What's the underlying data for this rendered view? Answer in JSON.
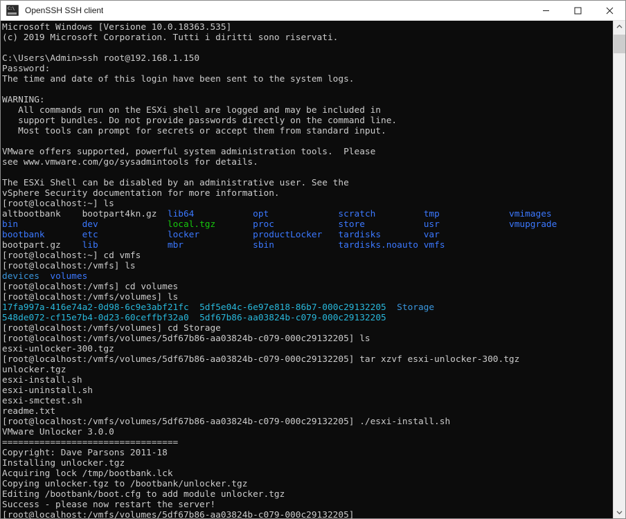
{
  "window": {
    "title": "OpenSSH SSH client",
    "icon": "console-icon",
    "controls": {
      "minimize": "Minimize",
      "maximize": "Maximize",
      "close": "Close"
    }
  },
  "scrollbar": {
    "up_arrow": "scroll-up",
    "down_arrow": "scroll-down",
    "thumb": "scroll-thumb"
  },
  "colors": {
    "background": "#0c0c0c",
    "foreground": "#cccccc",
    "blue": "#3b78ff",
    "green": "#16c60c",
    "cyan": "#29b8db",
    "teal": "#3a96dd",
    "titlebar_bg": "#ffffff",
    "titlebar_fg": "#1a1a1a",
    "scrollbar_bg": "#f0f0f0",
    "scrollbar_thumb": "#cdcdcd"
  },
  "terminal": {
    "lines": [
      {
        "text": "Microsoft Windows [Versione 10.0.18363.535]"
      },
      {
        "text": "(c) 2019 Microsoft Corporation. Tutti i diritti sono riservati."
      },
      {
        "text": ""
      },
      {
        "text": "C:\\Users\\Admin>ssh root@192.168.1.150"
      },
      {
        "text": "Password:"
      },
      {
        "text": "The time and date of this login have been sent to the system logs."
      },
      {
        "text": ""
      },
      {
        "text": "WARNING:"
      },
      {
        "text": "   All commands run on the ESXi shell are logged and may be included in"
      },
      {
        "text": "   support bundles. Do not provide passwords directly on the command line."
      },
      {
        "text": "   Most tools can prompt for secrets or accept them from standard input."
      },
      {
        "text": ""
      },
      {
        "text": "VMware offers supported, powerful system administration tools.  Please"
      },
      {
        "text": "see www.vmware.com/go/sysadmintools for details."
      },
      {
        "text": ""
      },
      {
        "text": "The ESXi Shell can be disabled by an administrative user. See the"
      },
      {
        "text": "vSphere Security documentation for more information."
      },
      {
        "text": "[root@localhost:~] ls"
      },
      {
        "segments": [
          {
            "text": "altbootbank    ",
            "color": "white"
          },
          {
            "text": "bootpart4kn.gz  ",
            "color": "white"
          },
          {
            "text": "lib64           ",
            "color": "blue"
          },
          {
            "text": "opt             ",
            "color": "blue"
          },
          {
            "text": "scratch         ",
            "color": "blue"
          },
          {
            "text": "tmp             ",
            "color": "blue"
          },
          {
            "text": "vmimages",
            "color": "blue"
          }
        ]
      },
      {
        "segments": [
          {
            "text": "bin            ",
            "color": "blue"
          },
          {
            "text": "dev             ",
            "color": "blue"
          },
          {
            "text": "local.tgz       ",
            "color": "green"
          },
          {
            "text": "proc            ",
            "color": "blue"
          },
          {
            "text": "store           ",
            "color": "blue"
          },
          {
            "text": "usr             ",
            "color": "blue"
          },
          {
            "text": "vmupgrade",
            "color": "blue"
          }
        ]
      },
      {
        "segments": [
          {
            "text": "bootbank       ",
            "color": "blue"
          },
          {
            "text": "etc             ",
            "color": "blue"
          },
          {
            "text": "locker          ",
            "color": "blue"
          },
          {
            "text": "productLocker   ",
            "color": "blue"
          },
          {
            "text": "tardisks        ",
            "color": "blue"
          },
          {
            "text": "var",
            "color": "blue"
          }
        ]
      },
      {
        "segments": [
          {
            "text": "bootpart.gz    ",
            "color": "white"
          },
          {
            "text": "lib             ",
            "color": "blue"
          },
          {
            "text": "mbr             ",
            "color": "blue"
          },
          {
            "text": "sbin            ",
            "color": "blue"
          },
          {
            "text": "tardisks.noauto ",
            "color": "blue"
          },
          {
            "text": "vmfs",
            "color": "blue"
          }
        ]
      },
      {
        "text": "[root@localhost:~] cd vmfs"
      },
      {
        "text": "[root@localhost:/vmfs] ls"
      },
      {
        "segments": [
          {
            "text": "devices",
            "color": "teal"
          },
          {
            "text": "  ",
            "color": "white"
          },
          {
            "text": "volumes",
            "color": "blue"
          }
        ]
      },
      {
        "text": "[root@localhost:/vmfs] cd volumes"
      },
      {
        "text": "[root@localhost:/vmfs/volumes] ls"
      },
      {
        "segments": [
          {
            "text": "17fa997a-416e74a2-0d98-6c9e3abf21fc",
            "color": "cyan"
          },
          {
            "text": "  ",
            "color": "white"
          },
          {
            "text": "5df5e04c-6e97e818-86b7-000c29132205",
            "color": "cyan"
          },
          {
            "text": "  ",
            "color": "white"
          },
          {
            "text": "Storage",
            "color": "teal"
          }
        ]
      },
      {
        "segments": [
          {
            "text": "548de072-cf15e7b4-0d23-60ceffbf32a0",
            "color": "cyan"
          },
          {
            "text": "  ",
            "color": "white"
          },
          {
            "text": "5df67b86-aa03824b-c079-000c29132205",
            "color": "cyan"
          }
        ]
      },
      {
        "text": "[root@localhost:/vmfs/volumes] cd Storage"
      },
      {
        "text": "[root@localhost:/vmfs/volumes/5df67b86-aa03824b-c079-000c29132205] ls"
      },
      {
        "text": "esxi-unlocker-300.tgz"
      },
      {
        "text": "[root@localhost:/vmfs/volumes/5df67b86-aa03824b-c079-000c29132205] tar xzvf esxi-unlocker-300.tgz"
      },
      {
        "text": "unlocker.tgz"
      },
      {
        "text": "esxi-install.sh"
      },
      {
        "text": "esxi-uninstall.sh"
      },
      {
        "text": "esxi-smctest.sh"
      },
      {
        "text": "readme.txt"
      },
      {
        "text": "[root@localhost:/vmfs/volumes/5df67b86-aa03824b-c079-000c29132205] ./esxi-install.sh"
      },
      {
        "text": "VMware Unlocker 3.0.0"
      },
      {
        "text": "================================="
      },
      {
        "text": "Copyright: Dave Parsons 2011-18"
      },
      {
        "text": "Installing unlocker.tgz"
      },
      {
        "text": "Acquiring lock /tmp/bootbank.lck"
      },
      {
        "text": "Copying unlocker.tgz to /bootbank/unlocker.tgz"
      },
      {
        "text": "Editing /bootbank/boot.cfg to add module unlocker.tgz"
      },
      {
        "text": "Success - please now restart the server!"
      },
      {
        "text": "[root@localhost:/vmfs/volumes/5df67b86-aa03824b-c079-000c29132205]"
      }
    ]
  }
}
